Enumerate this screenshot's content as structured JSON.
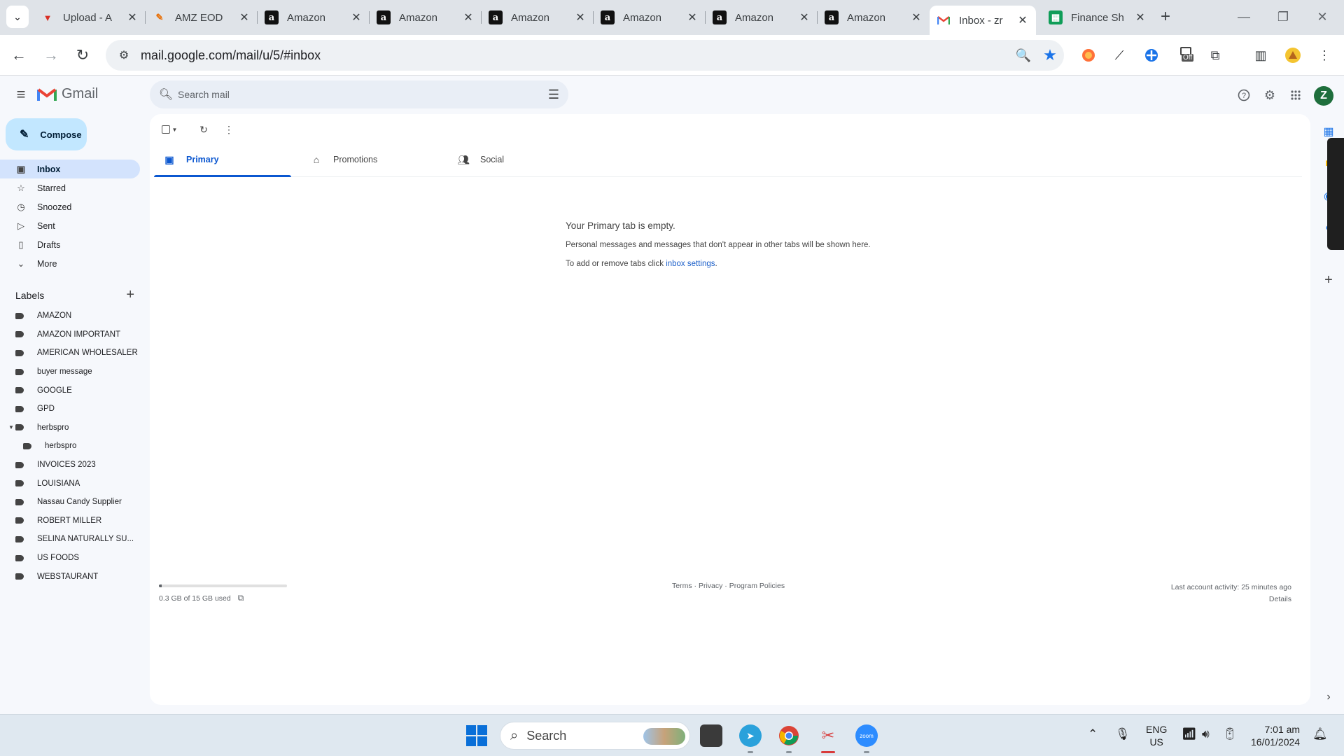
{
  "browser": {
    "tabs": [
      {
        "title": "Upload - A",
        "favicon": "upload-favicon"
      },
      {
        "title": "AMZ EOD",
        "favicon": "amz-eod-favicon"
      },
      {
        "title": "Amazon",
        "favicon": "a"
      },
      {
        "title": "Amazon",
        "favicon": "a"
      },
      {
        "title": "Amazon",
        "favicon": "a"
      },
      {
        "title": "Amazon",
        "favicon": "a"
      },
      {
        "title": "Amazon",
        "favicon": "a"
      },
      {
        "title": "Amazon",
        "favicon": "a"
      },
      {
        "title": "Inbox - zr",
        "favicon": "gmail-favicon"
      },
      {
        "title": "Finance Sh",
        "favicon": "sheets-favicon"
      }
    ],
    "close_glyph": "✕",
    "url": "mail.google.com/mail/u/5/#inbox",
    "extension_badge": "Off"
  },
  "gmail": {
    "app_name": "Gmail",
    "search": {
      "placeholder": "Search mail"
    },
    "avatar_letter": "Z",
    "compose_label": "Compose",
    "nav": [
      {
        "label": "Inbox",
        "icon": "inbox-icon"
      },
      {
        "label": "Starred",
        "icon": "star-icon"
      },
      {
        "label": "Snoozed",
        "icon": "clock-icon"
      },
      {
        "label": "Sent",
        "icon": "send-icon"
      },
      {
        "label": "Drafts",
        "icon": "draft-icon"
      },
      {
        "label": "More",
        "icon": "chevron-down-icon"
      }
    ],
    "labels_title": "Labels",
    "labels": [
      {
        "name": "AMAZON"
      },
      {
        "name": "AMAZON IMPORTANT"
      },
      {
        "name": "AMERICAN WHOLESALER"
      },
      {
        "name": "buyer message"
      },
      {
        "name": "GOOGLE"
      },
      {
        "name": "GPD"
      },
      {
        "name": "herbspro"
      },
      {
        "name": "herbspro"
      },
      {
        "name": "INVOICES 2023"
      },
      {
        "name": "LOUISIANA"
      },
      {
        "name": "Nassau Candy Supplier"
      },
      {
        "name": "ROBERT MILLER"
      },
      {
        "name": "SELINA NATURALLY SU..."
      },
      {
        "name": "US FOODS"
      },
      {
        "name": "WEBSTAURANT"
      }
    ],
    "tabs": [
      {
        "label": "Primary",
        "icon": "inbox-tab-icon"
      },
      {
        "label": "Promotions",
        "icon": "tag-icon"
      },
      {
        "label": "Social",
        "icon": "people-icon"
      }
    ],
    "empty": {
      "heading": "Your Primary tab is empty.",
      "line1": "Personal messages and messages that don't appear in other tabs will be shown here.",
      "line2_prefix": "To add or remove tabs click",
      "line2_link": "inbox settings",
      "line2_suffix": "."
    },
    "storage": {
      "text": "0.3 GB of 15 GB used",
      "fraction": 0.02
    },
    "footer": {
      "terms": "Terms",
      "privacy": "Privacy",
      "policies": "Program Policies",
      "sep": " · "
    },
    "activity": {
      "text": "Last account activity: 25 minutes ago",
      "details": "Details"
    }
  },
  "taskbar": {
    "search_label": "Search",
    "lang_top": "ENG",
    "lang_bottom": "US",
    "time": "7:01 am",
    "date": "16/01/2024",
    "zoom_label": "zoom"
  },
  "colors": {
    "accent": "#0b57d0",
    "compose_bg": "#c2e7ff",
    "inbox_active": "#d3e3fd"
  }
}
